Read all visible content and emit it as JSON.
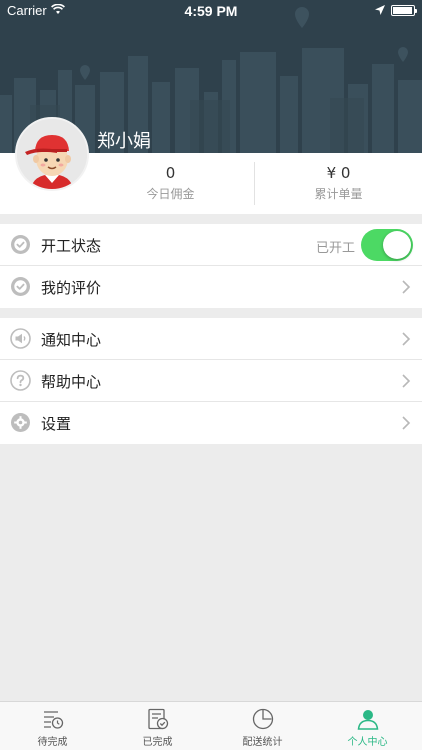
{
  "status_bar": {
    "carrier": "Carrier",
    "time": "4:59 PM",
    "battery_level": 0.95
  },
  "profile": {
    "name": "郑小娟"
  },
  "stats": [
    {
      "value": "0",
      "label": "今日佣金"
    },
    {
      "value": "¥ 0",
      "label": "累计单量"
    }
  ],
  "menu_group_1": [
    {
      "label": "开工状态",
      "state": "已开工",
      "toggle_on": true,
      "icon": "check-circle-icon"
    },
    {
      "label": "我的评价",
      "icon": "check-circle-icon"
    }
  ],
  "menu_group_2": [
    {
      "label": "通知中心",
      "icon": "megaphone-icon"
    },
    {
      "label": "帮助中心",
      "icon": "question-icon"
    },
    {
      "label": "设置",
      "icon": "gear-icon"
    }
  ],
  "tabs": [
    {
      "label": "待完成",
      "icon": "pending-list-icon"
    },
    {
      "label": "已完成",
      "icon": "completed-list-icon"
    },
    {
      "label": "配送统计",
      "icon": "pie-chart-icon"
    },
    {
      "label": "个人中心",
      "icon": "person-icon",
      "active": true
    }
  ],
  "colors": {
    "header": "#2f414c",
    "accent": "#2bb886",
    "toggle": "#4cd964"
  }
}
